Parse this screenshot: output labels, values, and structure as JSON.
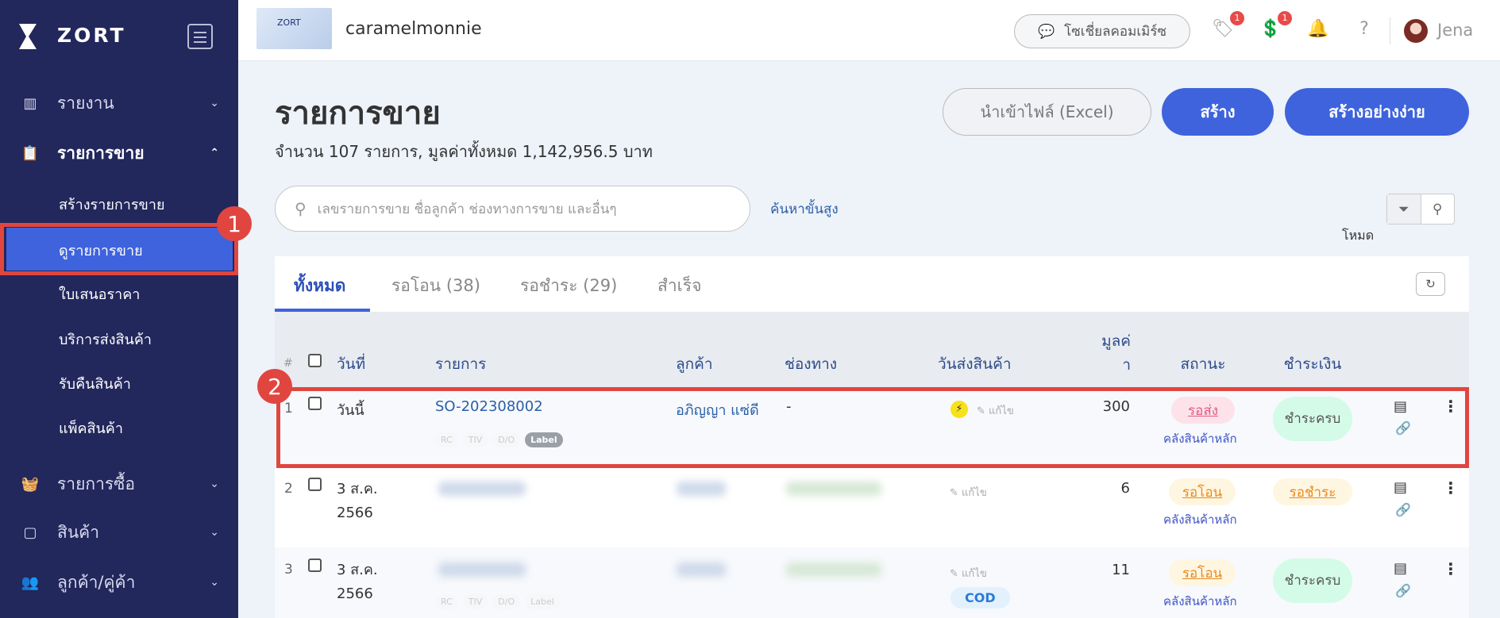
{
  "brand": {
    "name": "ZORT"
  },
  "sidebar": {
    "items": [
      {
        "label": "รายงาน",
        "icon": "bar-chart-icon"
      },
      {
        "label": "รายการขาย",
        "icon": "clipboard-icon"
      },
      {
        "label": "รายการซื้อ",
        "icon": "basket-icon"
      },
      {
        "label": "สินค้า",
        "icon": "box-icon"
      },
      {
        "label": "ลูกค้า/คู่ค้า",
        "icon": "users-icon"
      }
    ],
    "sub_items": [
      "สร้างรายการขาย",
      "ดูรายการขาย",
      "ใบเสนอราคา",
      "บริการส่งสินค้า",
      "รับคืนสินค้า",
      "แพ็คสินค้า"
    ]
  },
  "header": {
    "shop_name": "caramelmonnie",
    "shop_logo_text": "ZORT",
    "social_commerce": "โซเชี่ยลคอมเมิร์ซ",
    "badge1": "1",
    "badge2": "1",
    "user": "Jena"
  },
  "page": {
    "title": "รายการขาย",
    "summary": "จำนวน 107 รายการ, มูลค่าทั้งหมด 1,142,956.5 บาท",
    "import_btn": "นำเข้าไฟล์ (Excel)",
    "create_btn": "สร้าง",
    "quick_create_btn": "สร้างอย่างง่าย"
  },
  "search": {
    "placeholder": "เลขรายการขาย ชื่อลูกค้า ช่องทางการขาย และอื่นๆ",
    "advanced": "ค้นหาขั้นสูง",
    "mode": "โหมด"
  },
  "tabs": [
    "ทั้งหมด",
    "รอโอน (38)",
    "รอชำระ (29)",
    "สำเร็จ"
  ],
  "table": {
    "headers": {
      "num": "#",
      "date": "วันที่",
      "order": "รายการ",
      "customer": "ลูกค้า",
      "channel": "ช่องทาง",
      "ship_date": "วันส่งสินค้า",
      "value": "มูลค่า",
      "status": "สถานะ",
      "payment": "ชำระเงิน"
    },
    "edit_label": "แก้ไข",
    "chips": [
      "RC",
      "TIV",
      "D/O",
      "Label"
    ],
    "rows": [
      {
        "num": "1",
        "date": "วันนี้",
        "order": "SO-202308002",
        "customer": "อภิญญา แซ่ดี",
        "channel": "-",
        "value": "300",
        "status": "รอส่ง",
        "warehouse": "คลังสินค้าหลัก",
        "payment": "ชำระครบ"
      },
      {
        "num": "2",
        "date": "3 ส.ค. 2566",
        "value": "6",
        "status": "รอโอน",
        "warehouse": "คลังสินค้าหลัก",
        "payment": "รอชำระ"
      },
      {
        "num": "3",
        "date": "3 ส.ค. 2566",
        "value": "11",
        "status": "รอโอน",
        "warehouse": "คลังสินค้าหลัก",
        "payment": "ชำระครบ",
        "tag": "COD"
      }
    ]
  },
  "annotations": [
    "1",
    "2"
  ],
  "colors": {
    "sidebar": "#22275c",
    "primary": "#3e63dd",
    "annotation": "#e0463f"
  }
}
